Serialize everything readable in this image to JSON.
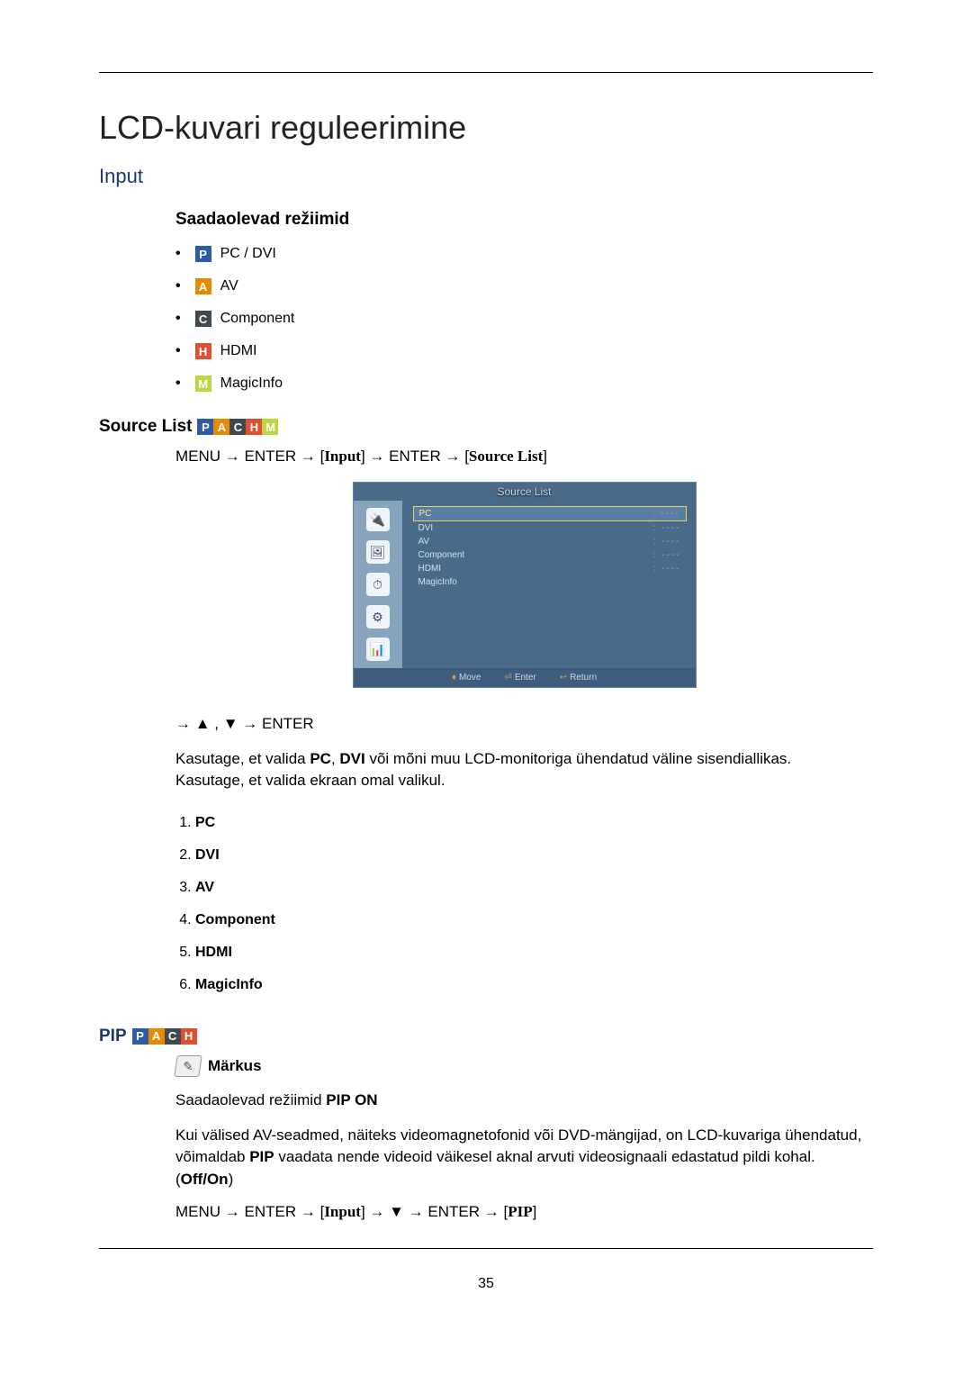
{
  "page": {
    "number": "35",
    "title": "LCD-kuvari reguleerimine"
  },
  "input_section": {
    "heading": "Input",
    "modes_heading": "Saadaolevad režiimid",
    "modes": {
      "pc_dvi": "PC / DVI",
      "av": "AV",
      "component": "Component",
      "hdmi": "HDMI",
      "magicinfo": "MagicInfo"
    },
    "badge_letters": {
      "p": "P",
      "a": "A",
      "c": "C",
      "h": "H",
      "m": "M"
    }
  },
  "source_list": {
    "heading": "Source List",
    "menu_path": {
      "p1": "MENU",
      "p2": "ENTER",
      "p3": "Input",
      "p4": "ENTER",
      "p5": "Source List"
    },
    "nav_line": "→ ▲ , ▼ → ENTER",
    "desc_line1": "Kasutage, et valida PC, DVI või mõni muu LCD-monitoriga ühendatud väline sisendiallikas.",
    "desc_line2": "Kasutage, et valida ekraan omal valikul.",
    "desc_bold_pc": "PC",
    "desc_bold_dvi": "DVI",
    "items": [
      "PC",
      "DVI",
      "AV",
      "Component",
      "HDMI",
      "MagicInfo"
    ]
  },
  "osd": {
    "title": "Source List",
    "rows": [
      {
        "label": "PC",
        "sel": true
      },
      {
        "label": "DVI",
        "sel": false
      },
      {
        "label": "AV",
        "sel": false
      },
      {
        "label": "Component",
        "sel": false
      },
      {
        "label": "HDMI",
        "sel": false
      },
      {
        "label": "MagicInfo",
        "sel": false
      }
    ],
    "footer": {
      "move": "Move",
      "enter": "Enter",
      "return": "Return"
    }
  },
  "pip": {
    "heading": "PIP",
    "note_label": "Märkus",
    "note_text_prefix": "Saadaolevad režiimid ",
    "note_text_bold": "PIP ON",
    "body_1_a": "Kui välised AV-seadmed, näiteks videomagnetofonid või DVD-mängijad, on LCD-kuvariga ühendatud, võimaldab ",
    "body_1_bold_pip": "PIP",
    "body_1_b": " vaadata nende videoid väikesel aknal arvuti videosignaali edastatud pildi kohal. (",
    "body_1_bold_offon": "Off/On",
    "body_1_c": ")",
    "menu_path": {
      "p1": "MENU",
      "p2": "ENTER",
      "p3": "Input",
      "arrow_down": "▼",
      "p4": "ENTER",
      "p5": "PIP"
    }
  }
}
